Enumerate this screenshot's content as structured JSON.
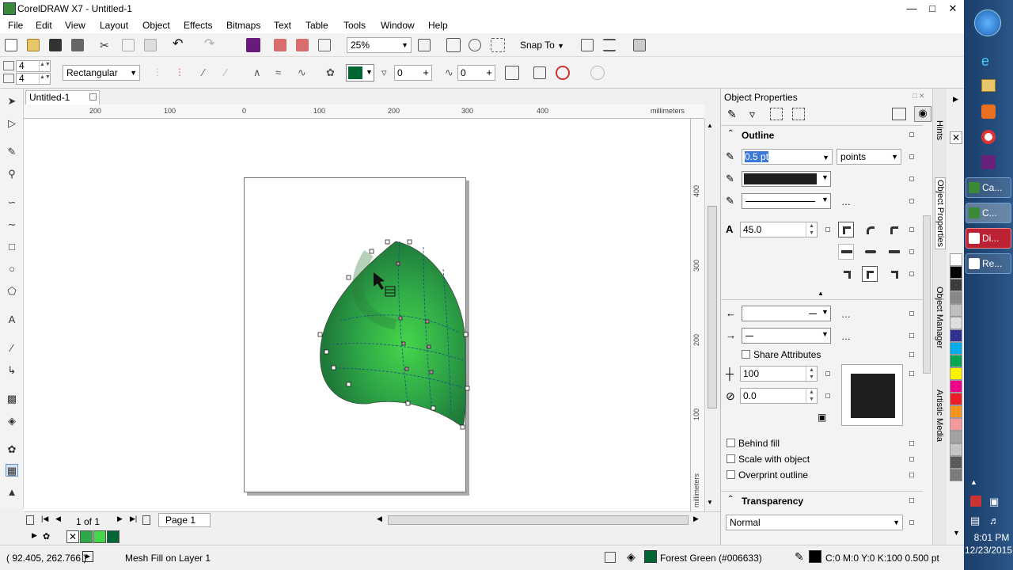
{
  "window": {
    "title": "CorelDRAW X7 - Untitled-1"
  },
  "menu": [
    "File",
    "Edit",
    "View",
    "Layout",
    "Object",
    "Effects",
    "Bitmaps",
    "Text",
    "Table",
    "Tools",
    "Window",
    "Help"
  ],
  "toolbar": {
    "zoom": "25%",
    "snap_to": "Snap To"
  },
  "propbar": {
    "rows": "4",
    "cols": "4",
    "mesh_type": "Rectangular",
    "transparency": "0",
    "smoothness": "0"
  },
  "document": {
    "tab": "Untitled-1"
  },
  "ruler": {
    "h_ticks": [
      "200",
      "100",
      "0",
      "100",
      "200",
      "300",
      "400"
    ],
    "unit": "millimeters",
    "v_ticks": [
      "400",
      "300",
      "200",
      "100"
    ]
  },
  "pagenav": {
    "count": "1 of 1",
    "page": "Page 1"
  },
  "status": {
    "coords": "( 92.405, 262.766 )",
    "info": "Mesh Fill on Layer 1",
    "fill_name": "Forest Green (#006633)",
    "outline": "C:0 M:0 Y:0 K:100  0.500 pt"
  },
  "docker": {
    "title": "Object Properties",
    "outline_label": "Outline",
    "width": "0.5 pt",
    "units": "points",
    "miter": "45.0",
    "share_attributes": "Share Attributes",
    "stretch": "100",
    "angle": "0.0",
    "behind_fill": "Behind fill",
    "scale_with_object": "Scale with object",
    "overprint_outline": "Overprint outline",
    "transparency_label": "Transparency",
    "blend_mode": "Normal"
  },
  "docktabs": [
    "Hints",
    "Object Properties",
    "Object Manager",
    "Artistic Media"
  ],
  "taskbar": {
    "items": [
      "Ca...",
      "C...",
      "Di...",
      "Re..."
    ],
    "time": "8:01 PM",
    "date": "12/23/2015"
  },
  "colors": {
    "accent_green": "#006633",
    "palette": [
      "#ffffff",
      "#000000",
      "#3b3b3b",
      "#888888",
      "#bfbfbf",
      "#dddddd",
      "#2e3192",
      "#00aeef",
      "#00a651",
      "#fff200",
      "#ec008c",
      "#ed1c24",
      "#f7941d",
      "#f5989d",
      "#a1a1a1",
      "#c4c4c4",
      "#5a5a5a",
      "#7a7a7a"
    ]
  }
}
